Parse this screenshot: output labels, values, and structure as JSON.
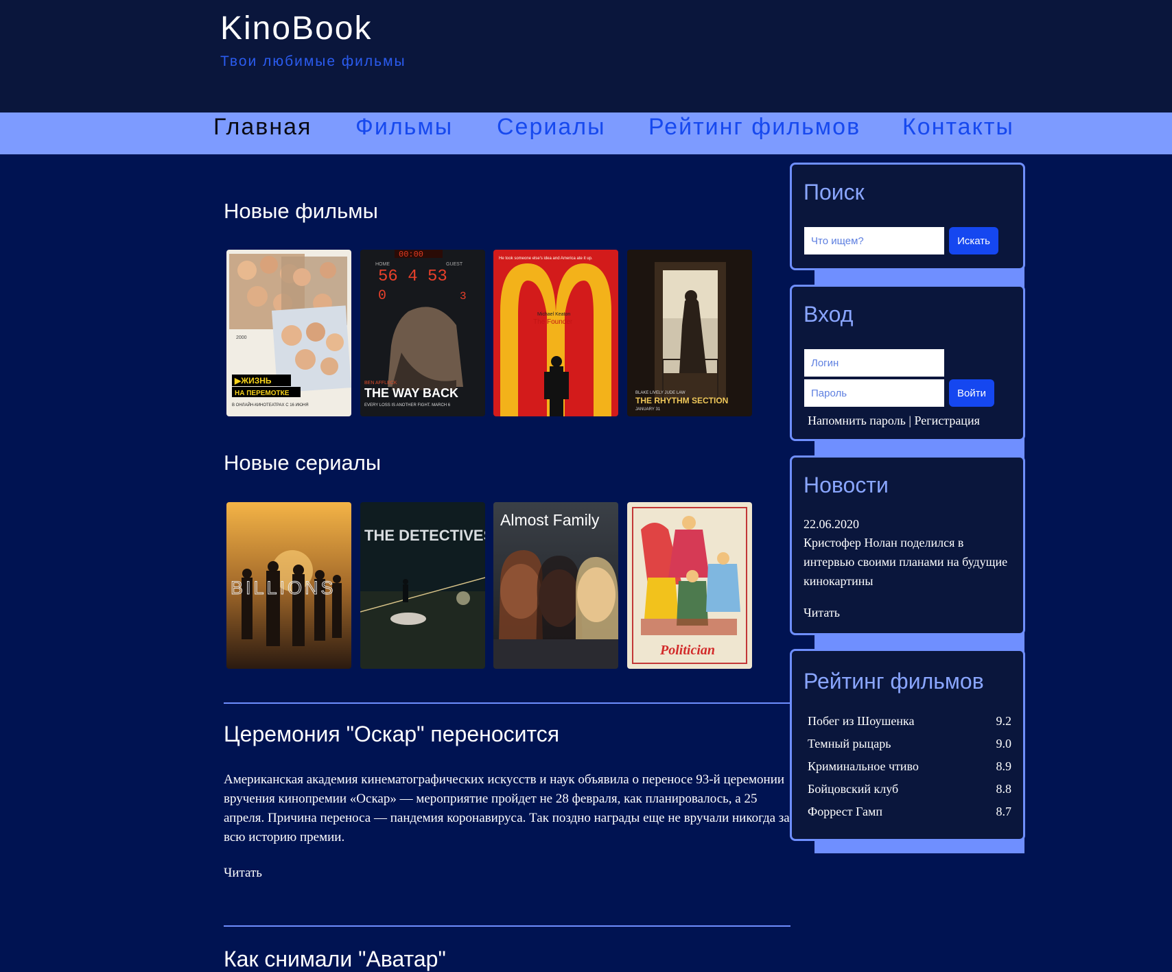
{
  "header": {
    "title": "KinoBook",
    "tagline": "Твои любимые фильмы"
  },
  "nav": {
    "items": [
      {
        "label": "Главная"
      },
      {
        "label": "Фильмы"
      },
      {
        "label": "Сериалы"
      },
      {
        "label": "Рейтинг фильмов"
      },
      {
        "label": "Контакты"
      }
    ]
  },
  "main": {
    "new_films_title": "Новые фильмы",
    "films": [
      {
        "name": "Жизнь на перемотке",
        "caption": "ЖИЗНЬ НА ПЕРЕМОТКЕ"
      },
      {
        "name": "The Way Back",
        "caption": "THE WAY BACK",
        "scoreboard": "56 4 53",
        "actor": "BEN AFFLECK"
      },
      {
        "name": "The Founder",
        "caption": "The Founder",
        "actor": "Michael Keaton"
      },
      {
        "name": "The Rhythm Section",
        "caption": "THE RHYTHM SECTION",
        "actor": "BLAKE LIVELY  JUDE LAW"
      }
    ],
    "new_series_title": "Новые сериалы",
    "series": [
      {
        "name": "Billions",
        "caption": "BILLIONS"
      },
      {
        "name": "The Detectives",
        "caption": "THE DETECTIVES"
      },
      {
        "name": "Almost Family",
        "caption": "Almost Family"
      },
      {
        "name": "The Politician",
        "caption": "Politician"
      }
    ],
    "articles": [
      {
        "title": "Церемония \"Оскар\" переносится",
        "text": "Американская академия кинематографических искусств и наук объявила о переносе 93-й церемонии вручения кинопремии «Оскар» — мероприятие пройдет не 28 февраля, как планировалось, а 25 апреля. Причина переноса — пандемия коронавируса. Так поздно награды еще не вручали никогда за всю историю премии.",
        "read": "Читать"
      },
      {
        "title": "Как снимали \"Аватар\""
      }
    ]
  },
  "sidebar": {
    "search": {
      "title": "Поиск",
      "placeholder": "Что ищем?",
      "button": "Искать"
    },
    "login": {
      "title": "Вход",
      "login_placeholder": "Логин",
      "password_placeholder": "Пароль",
      "button": "Войти",
      "remind": "Напомнить пароль",
      "separator": "|",
      "register": "Регистрация"
    },
    "news": {
      "title": "Новости",
      "date": "22.06.2020",
      "text": "Кристофер Нолан поделился в интервью своими планами на будущие кинокартины",
      "read": "Читать"
    },
    "rating": {
      "title": "Рейтинг фильмов",
      "items": [
        {
          "title": "Побег из Шоушенка",
          "score": "9.2"
        },
        {
          "title": "Темный рыцарь",
          "score": "9.0"
        },
        {
          "title": "Криминальное чтиво",
          "score": "8.9"
        },
        {
          "title": "Бойцовский клуб",
          "score": "8.8"
        },
        {
          "title": "Форрест Гамп",
          "score": "8.7"
        }
      ]
    }
  },
  "colors": {
    "page_bg": "#001352",
    "header_bg": "#0a163c",
    "nav_bg": "#7d9bff",
    "accent": "#1547f0",
    "widget_border": "#6f8fff"
  }
}
